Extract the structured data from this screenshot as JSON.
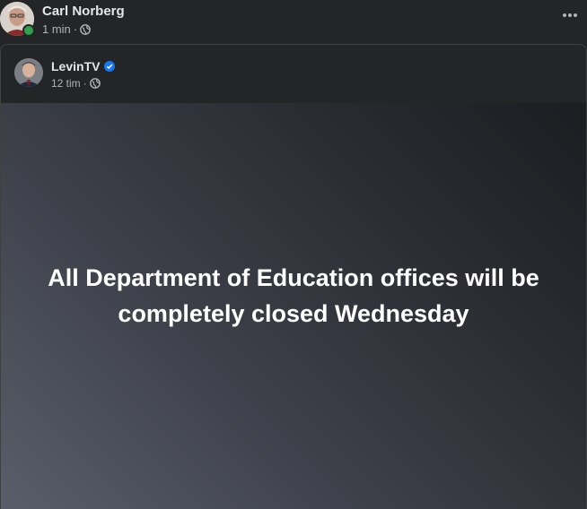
{
  "post": {
    "author_name": "Carl Norberg",
    "time": "1 min",
    "separator": "·",
    "privacy_icon": "globe-icon",
    "more_icon": "ellipsis-icon"
  },
  "shared": {
    "author_name": "LevinTV",
    "verified_icon": "verified-badge-icon",
    "time": "12 tim",
    "separator": "·",
    "privacy_icon": "globe-icon",
    "text": "All Department of Education offices will be completely closed Wednesday"
  },
  "colors": {
    "online": "#31a24c",
    "verified": "#1877f2",
    "background": "#242526"
  }
}
